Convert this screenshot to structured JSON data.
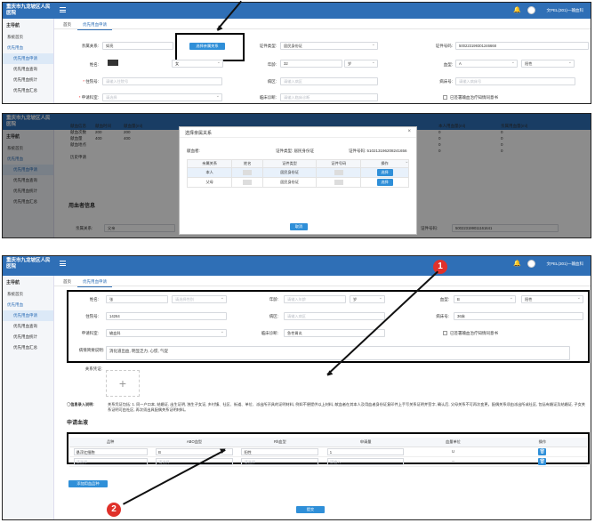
{
  "app": {
    "title": "重庆市九龙坡区人民医院",
    "user": "文PEL(301)一输血科",
    "nav_title": "主导航",
    "nav_items": [
      "系统首页",
      "优先用血",
      "优先用血申请",
      "优先用血查询",
      "优先用血统计",
      "优先用血汇总"
    ],
    "tab_home": "首页",
    "tab_active": "优先用血申请"
  },
  "panel1": {
    "relation_label": "亲属关系:",
    "relation_value": "如亮",
    "choose_relation_button": "选择亲属关系",
    "id_type_label": "证件类型:",
    "id_type_value": "居民身份证",
    "id_no_label": "证件号码:",
    "id_no_value": "500223199301246668",
    "name_label": "姓名:",
    "gender_value": "女",
    "age_label": "年龄:",
    "age_value": "32",
    "age_unit": "岁",
    "blood_type_label": "血型:",
    "abo_value": "A",
    "rh_value": "阳性",
    "hosp_no_label": "住院号:",
    "hosp_no_ph": "请输入住院号",
    "ward_label": "病区:",
    "ward_ph": "请输入病区",
    "bed_label": "病床号:",
    "bed_ph": "请输入病床号",
    "apply_dept_label": "申请科室:",
    "apply_dept_ph": "请选择",
    "diagnosis_label": "临床诊断:",
    "diagnosis_ph": "请输入临床诊断",
    "consent_label": "已签署输血治疗知情同意书"
  },
  "panel2": {
    "bg_side": [
      "献血信息",
      "献血次数",
      "献血量",
      "献血地点",
      "",
      "历史申请",
      "",
      ""
    ],
    "bg_cols": [
      "献血时间",
      "献血量(ml)",
      "献血地点"
    ],
    "bg_values": [
      "",
      "200",
      "400",
      "",
      "",
      "",
      "",
      ""
    ],
    "bg_right_cols": [
      "本人用血量(ml)",
      "亲属用血量(ml)"
    ],
    "bg_right_vals": [
      "0",
      "0",
      "0",
      "0",
      "0"
    ],
    "bg_section": "用血者信息",
    "bg_relation_label": "亲属关系:",
    "bg_relation_val": "父亲",
    "bg_id_label": "证件号码:",
    "bg_id_val": "500223199011161641",
    "dialog_title": "选择亲属关系",
    "donor_label": "献血者:",
    "id_type_text": "证件类型: 居民身份证",
    "id_no_text": "证件号码: 510213196208241656",
    "headers": [
      "亲属关系",
      "姓名",
      "证件类型",
      "证件号码",
      "操作"
    ],
    "rows": [
      {
        "relation": "本人",
        "id_type": "居民身份证",
        "action": "选择"
      },
      {
        "relation": "父母",
        "id_type": "居民身份证",
        "action": "选择"
      }
    ],
    "cancel_button": "取消"
  },
  "panel3": {
    "name_label": "姓名:",
    "name_value": "张",
    "name_ph": "请选择性别",
    "age_label": "年龄:",
    "age_ph": "请输入年龄",
    "age_unit": "岁",
    "blood_type_label": "血型:",
    "abo_value": "B",
    "rh_value": "阳性",
    "hosp_no_label": "住院号:",
    "hosp_no_value": "14264",
    "ward_label": "病区:",
    "ward_ph": "请输入病区",
    "bed_label": "病床号:",
    "bed_value": "36床",
    "apply_dept_label": "申请科室:",
    "apply_dept_value": "输血科",
    "diagnosis_label": "临床诊断:",
    "diagnosis_value": "急性胃炎",
    "consent_label": "已签署输血治疗知情同意书",
    "reason_label": "病情简要说明:",
    "reason_value": "消化道出血, 明显乏力, 心慌, 气促",
    "proof_label": "关系凭证:",
    "info_note": "◯信息录入说明:",
    "info_text": "关系凭证包括: 1. 同一户口本, 结婚证, 出生证明, 独生子女证, 乡村镇、社区、街道、单位、派出所开具的证明材料, 例如不便提供以上材料, 献血者在其本人及用血者身份证复印件上手写关系证明并签字, 确认后, 父母关系不可再次变更。配偶关系须由派出所或社区, 包括有婚证及结婚证, 子女关系证明可由社区, 再次须出具配偶关系证明材料。",
    "blood_section": "申请血液",
    "table_headers": [
      "品种",
      "ABO血型",
      "Rh血型",
      "申请量",
      "血量单位",
      "操作"
    ],
    "row1": {
      "kind": "悬浮红细胞",
      "abo": "B",
      "rh": "阳性",
      "amount": "1",
      "unit": "U",
      "del": "🗑"
    },
    "row2": {
      "kind_ph": "请选择",
      "abo_ph": "请选择",
      "rh_ph": "请选择",
      "amount_ph": "请输入",
      "unit": "--",
      "del": "🗑"
    },
    "add_button": "添加用血品种",
    "submit_button": "提交"
  },
  "annotations": {
    "marker1": "1",
    "marker2": "2"
  }
}
